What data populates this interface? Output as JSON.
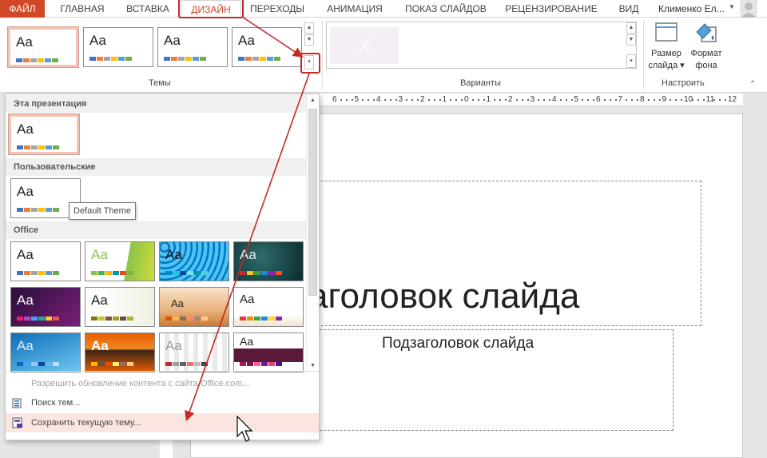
{
  "tabs": [
    {
      "label": "ФАЙЛ",
      "kind": "file"
    },
    {
      "label": "ГЛАВНАЯ"
    },
    {
      "label": "ВСТАВКА"
    },
    {
      "label": "ДИЗАЙН",
      "kind": "active"
    },
    {
      "label": "ПЕРЕХОДЫ"
    },
    {
      "label": "АНИМАЦИЯ"
    },
    {
      "label": "ПОКАЗ СЛАЙДОВ"
    },
    {
      "label": "РЕЦЕНЗИРОВАНИЕ"
    },
    {
      "label": "ВИД"
    }
  ],
  "user": {
    "name": "Клименко Ел..."
  },
  "ribbon": {
    "themes_label": "Темы",
    "variants_label": "Варианты",
    "customize_label": "Настроить",
    "slide_size": {
      "line1": "Размер",
      "line2": "слайда"
    },
    "format_bg": {
      "line1": "Формат",
      "line2": "фона"
    }
  },
  "theme_thumb_text": "Aa",
  "swatch_colors": [
    "#4472c4",
    "#ed7d31",
    "#a5a5a5",
    "#ffc000",
    "#5b9bd5",
    "#70ad47"
  ],
  "dropdown": {
    "section_this": "Эта презентация",
    "section_custom": "Пользовательские",
    "section_office": "Office",
    "tooltip": "Default Theme",
    "menu_allow_update": "Разрешить обновление контента с сайта Office.com...",
    "menu_browse": "Поиск тем...",
    "menu_save": "Сохранить текущую тему..."
  },
  "ruler": {
    "numbers": [
      "6",
      "5",
      "4",
      "3",
      "2",
      "1",
      "0",
      "1",
      "2",
      "3",
      "4",
      "5",
      "6",
      "7",
      "8",
      "9",
      "10",
      "11",
      "12"
    ]
  },
  "slide": {
    "title": "аголовок слайда",
    "subtitle": "Подзаголовок слайда"
  },
  "colors": {
    "accent": "#d24726",
    "annotation": "#c62828"
  }
}
